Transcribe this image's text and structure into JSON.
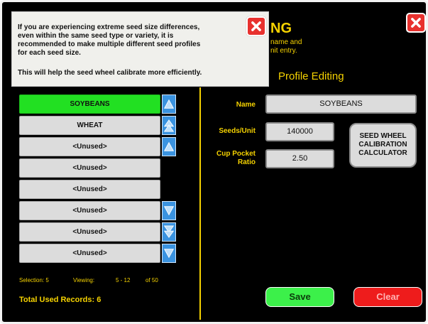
{
  "header": {
    "title_fragment": "NG",
    "subtitle_line1": "name and",
    "subtitle_line2": "nit entry.",
    "section_title": "Profile Editing"
  },
  "popup": {
    "lines": [
      "If you are experiencing extreme seed size differences,",
      "even within the same seed type or variety, it is",
      "recommended to make multiple different seed profiles",
      "for each seed size.",
      "This will help the seed wheel calibrate more efficiently."
    ]
  },
  "list": {
    "items": [
      {
        "label": "SOYBEANS",
        "selected": true
      },
      {
        "label": "WHEAT",
        "selected": false
      },
      {
        "label": "<Unused>",
        "selected": false
      },
      {
        "label": "<Unused>",
        "selected": false
      },
      {
        "label": "<Unused>",
        "selected": false
      },
      {
        "label": "<Unused>",
        "selected": false
      },
      {
        "label": "<Unused>",
        "selected": false
      },
      {
        "label": "<Unused>",
        "selected": false
      }
    ],
    "scroll_up_icons": [
      "arrow-up-icon",
      "double-arrow-up-icon",
      "page-up-icon"
    ],
    "scroll_down_icons": [
      "arrow-down-icon",
      "double-arrow-down-icon",
      "page-down-icon"
    ]
  },
  "status": {
    "selection": "Selection: 5",
    "viewing_label": "Viewing:",
    "viewing_range": "5 - 12",
    "of_total": "of 50",
    "total_records": "Total Used Records: 6"
  },
  "form": {
    "name_label": "Name",
    "name_value": "SOYBEANS",
    "seeds_label": "Seeds/Unit",
    "seeds_value": "140000",
    "cup_label_line1": "Cup Pocket",
    "cup_label_line2": "Ratio",
    "cup_value": "2.50",
    "calc_line1": "SEED WHEEL",
    "calc_line2": "CALIBRATION",
    "calc_line3": "CALCULATOR"
  },
  "actions": {
    "save_label": "Save",
    "clear_label": "Clear"
  },
  "colors": {
    "accent_yellow": "#f5d200",
    "selected_green": "#22e022",
    "scroll_blue": "#3a93e0",
    "close_red": "#e8312e",
    "save_green": "#3cf04a",
    "clear_red": "#ee1c1c"
  }
}
